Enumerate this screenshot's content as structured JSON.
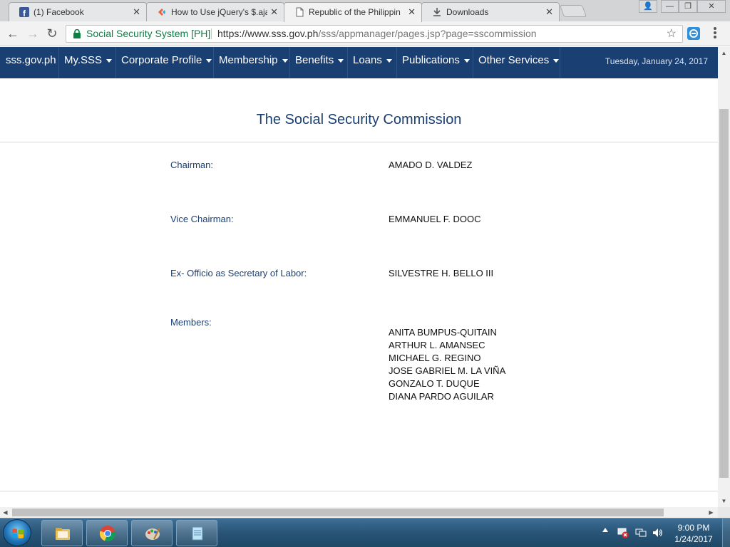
{
  "browser": {
    "tabs": [
      {
        "title": "(1) Facebook",
        "icon": "facebook-icon"
      },
      {
        "title": "How to Use jQuery's $.aja",
        "icon": "sitepoint-icon"
      },
      {
        "title": "Republic of the Philippin",
        "icon": "document-icon",
        "active": true
      },
      {
        "title": "Downloads",
        "icon": "download-icon"
      }
    ],
    "close_glyph": "✕",
    "window_controls": {
      "user": "👤",
      "minimize": "—",
      "maximize": "❐",
      "close": "✕"
    },
    "secure_label": "Social Security System [PH]",
    "url_host": "https://www.sss.gov.ph",
    "url_path": "/sss/appmanager/pages.jsp?page=sscommission",
    "star_glyph": "☆",
    "nav_glyphs": {
      "back": "←",
      "forward": "→",
      "reload": "↻"
    }
  },
  "sitenav": {
    "home": "sss.gov.ph",
    "items": [
      {
        "label": "My.SSS"
      },
      {
        "label": "Corporate Profile"
      },
      {
        "label": "Membership"
      },
      {
        "label": "Benefits"
      },
      {
        "label": "Loans"
      },
      {
        "label": "Publications"
      },
      {
        "label": "Other Services"
      }
    ],
    "date": "Tuesday, January 24, 2017",
    "colors": {
      "bar": "#1a3f72",
      "title": "#1a3f72"
    }
  },
  "commission": {
    "title": "The Social Security Commission",
    "rows": [
      {
        "role": "Chairman:",
        "name": "AMADO D. VALDEZ"
      },
      {
        "role": "Vice Chairman:",
        "name": "EMMANUEL F. DOOC"
      },
      {
        "role": "Ex- Officio as Secretary of Labor:",
        "name": "SILVESTRE H. BELLO III"
      }
    ],
    "members_label": "Members:",
    "members": [
      "ANITA BUMPUS-QUITAIN",
      "ARTHUR L. AMANSEC",
      "MICHAEL G. REGINO",
      "JOSE GABRIEL M. LA VIÑA",
      "GONZALO T. DUQUE",
      "DIANA PARDO AGUILAR"
    ]
  },
  "taskbar": {
    "pinned": [
      "explorer-icon",
      "chrome-icon",
      "paint-icon",
      "notepad-icon"
    ],
    "tray": [
      "network-error-icon",
      "display-icon",
      "volume-icon"
    ],
    "time": "9:00 PM",
    "date": "1/24/2017"
  }
}
